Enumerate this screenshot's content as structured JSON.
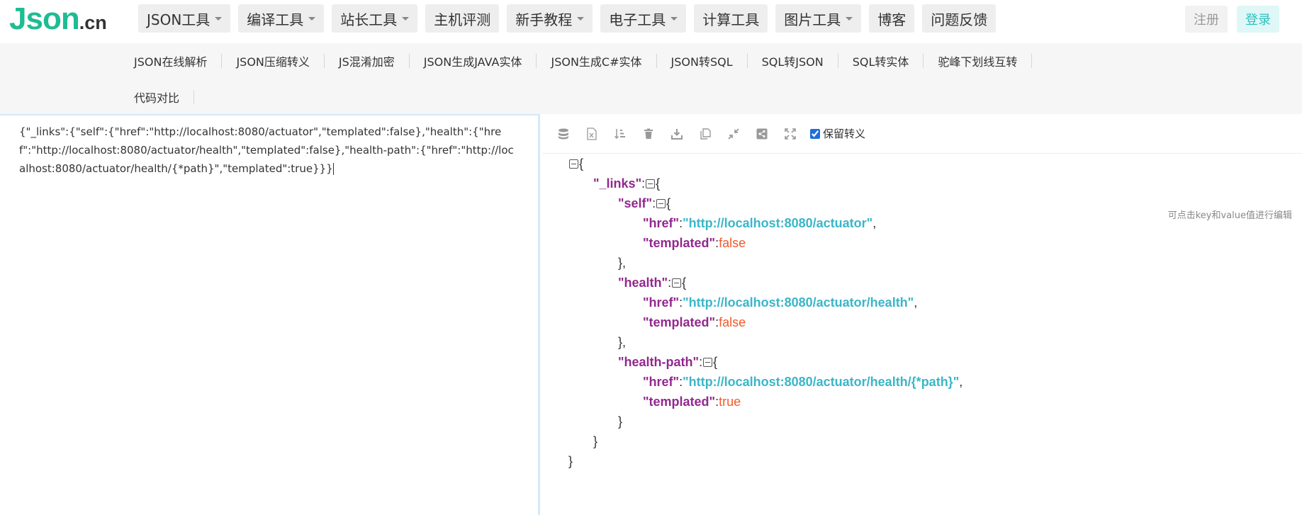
{
  "logo": {
    "main": "Json",
    "tld": ".cn"
  },
  "nav": [
    {
      "label": "JSON工具",
      "dropdown": true
    },
    {
      "label": "编译工具",
      "dropdown": true
    },
    {
      "label": "站长工具",
      "dropdown": true
    },
    {
      "label": "主机评测",
      "dropdown": false
    },
    {
      "label": "新手教程",
      "dropdown": true
    },
    {
      "label": "电子工具",
      "dropdown": true
    },
    {
      "label": "计算工具",
      "dropdown": false
    },
    {
      "label": "图片工具",
      "dropdown": true
    },
    {
      "label": "博客",
      "dropdown": false
    },
    {
      "label": "问题反馈",
      "dropdown": false
    }
  ],
  "auth": {
    "register": "注册",
    "login": "登录"
  },
  "subnav": {
    "row1": [
      "JSON在线解析",
      "JSON压缩转义",
      "JS混淆加密",
      "JSON生成JAVA实体",
      "JSON生成C#实体",
      "JSON转SQL",
      "SQL转JSON",
      "SQL转实体",
      "驼峰下划线互转"
    ],
    "row2": [
      "代码对比"
    ]
  },
  "editor": {
    "content": "{\"_links\":{\"self\":{\"href\":\"http://localhost:8080/actuator\",\"templated\":false},\"health\":{\"href\":\"http://localhost:8080/actuator/health\",\"templated\":false},\"health-path\":{\"href\":\"http://localhost:8080/actuator/health/{*path}\",\"templated\":true}}}"
  },
  "toolbar": {
    "icons": [
      "database-icon",
      "excel-icon",
      "sort-icon",
      "trash-icon",
      "download-icon",
      "copy-icon",
      "compress-icon",
      "share-icon",
      "expand-icon"
    ],
    "keep_escape_label": "保留转义",
    "keep_escape_checked": true
  },
  "hint": "可点击key和value值进行编辑",
  "tree": {
    "root_open": "{",
    "root_close": "}",
    "links_key": "\"_links\"",
    "self_key": "\"self\"",
    "self_href_key": "\"href\"",
    "self_href_val": "\"http://localhost:8080/actuator\"",
    "self_templated_key": "\"templated\"",
    "self_templated_val": "false",
    "health_key": "\"health\"",
    "health_href_key": "\"href\"",
    "health_href_val": "\"http://localhost:8080/actuator/health\"",
    "health_templated_key": "\"templated\"",
    "health_templated_val": "false",
    "hp_key": "\"health-path\"",
    "hp_href_key": "\"href\"",
    "hp_href_val": "\"http://localhost:8080/actuator/health/{*path}\"",
    "hp_templated_key": "\"templated\"",
    "hp_templated_val": "true"
  }
}
